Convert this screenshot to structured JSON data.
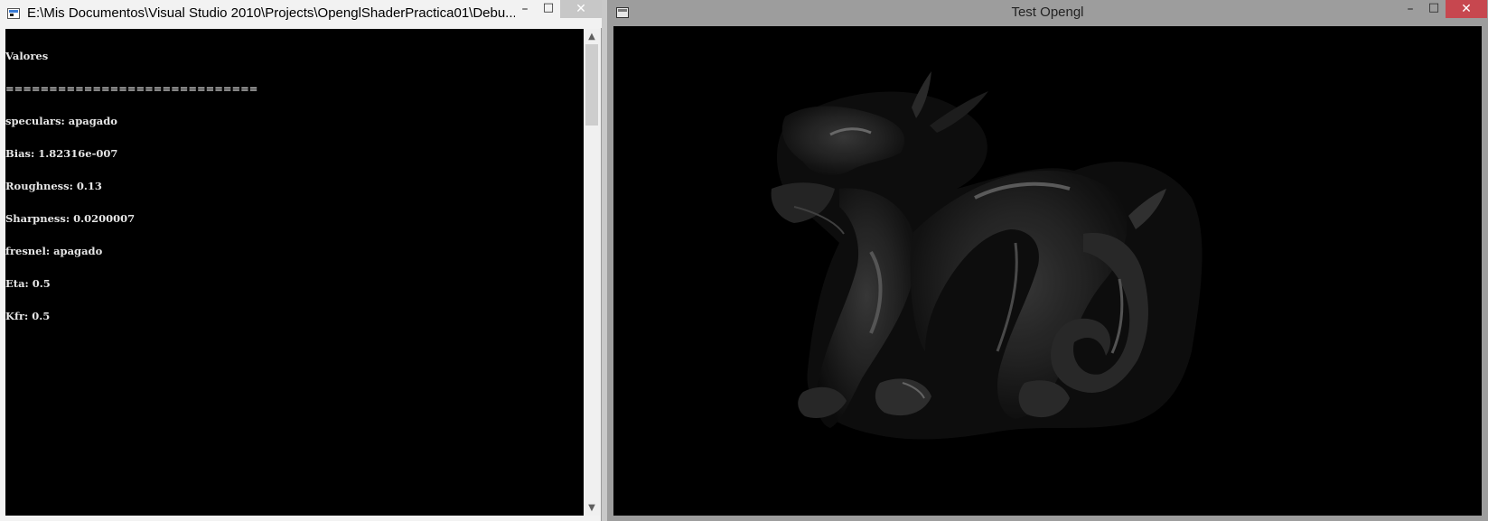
{
  "console_window": {
    "title": "E:\\Mis Documentos\\Visual Studio 2010\\Projects\\OpenglShaderPractica01\\Debu...",
    "minimize_label": "–",
    "maximize_label": "□",
    "close_label": "✕",
    "lines": [
      "Valores",
      "=============================",
      "speculars: apagado",
      "Bias: 1.82316e-007",
      "Roughness: 0.13",
      "Sharpness: 0.0200007",
      "fresnel: apagado",
      "Eta: 0.5",
      "Kfr: 0.5"
    ],
    "scroll_up_label": "▲",
    "scroll_down_label": "▼"
  },
  "gl_window": {
    "title": "Test Opengl",
    "minimize_label": "–",
    "maximize_label": "□",
    "close_label": "✕",
    "scene": "dragon-model"
  },
  "colors": {
    "console_bg": "#000000",
    "console_text": "#e6e6e6",
    "active_close": "#c7474f",
    "gl_frame": "#9d9d9d"
  }
}
